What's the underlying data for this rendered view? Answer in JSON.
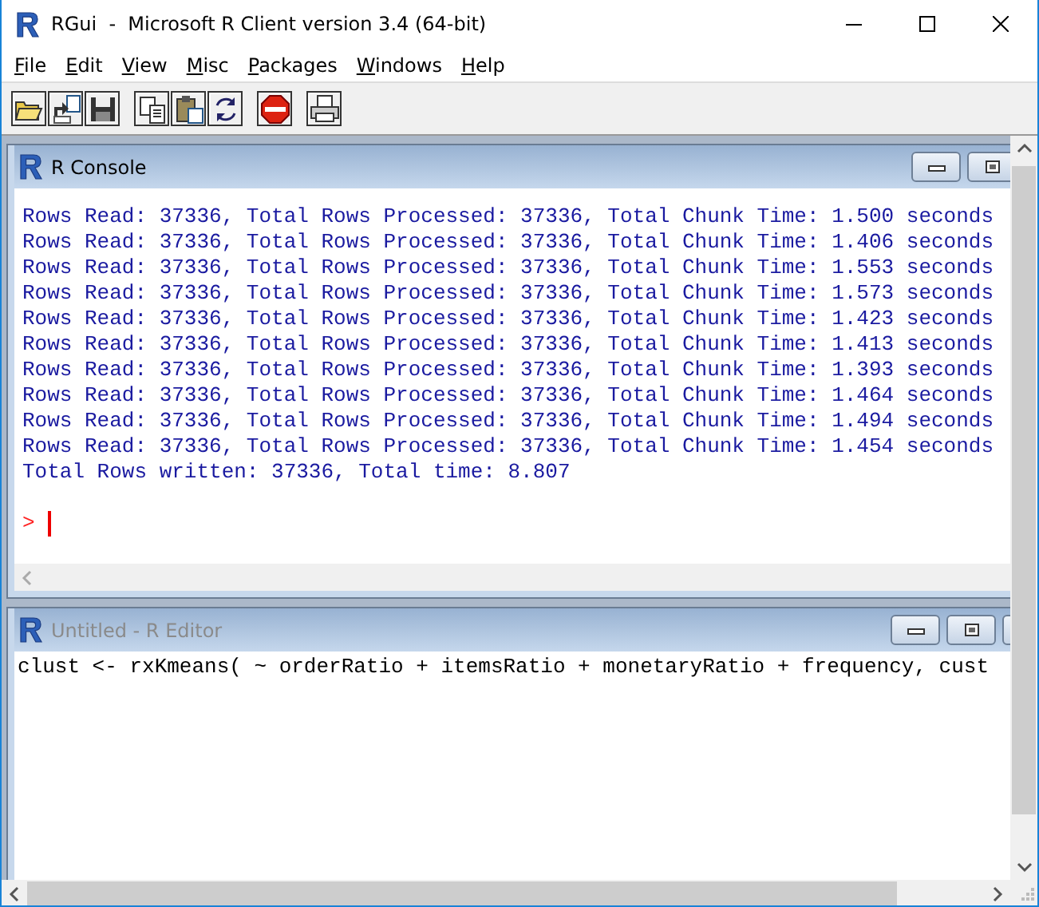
{
  "window": {
    "title": "RGui  -  Microsoft R Client version 3.4 (64-bit)"
  },
  "menu": [
    "File",
    "Edit",
    "View",
    "Misc",
    "Packages",
    "Windows",
    "Help"
  ],
  "toolbar": [
    {
      "buttons": [
        {
          "kind": "open"
        },
        {
          "kind": "load"
        },
        {
          "kind": "save"
        }
      ]
    },
    {
      "buttons": [
        {
          "kind": "copy"
        },
        {
          "kind": "paste"
        },
        {
          "kind": "refresh"
        }
      ]
    },
    {
      "buttons": [
        {
          "kind": "stop"
        }
      ]
    },
    {
      "buttons": [
        {
          "kind": "print"
        }
      ]
    }
  ],
  "console": {
    "title": "R Console",
    "active": true,
    "lines": [
      "Rows Read: 37336, Total Rows Processed: 37336, Total Chunk Time: 1.500 seconds",
      "Rows Read: 37336, Total Rows Processed: 37336, Total Chunk Time: 1.406 seconds",
      "Rows Read: 37336, Total Rows Processed: 37336, Total Chunk Time: 1.553 seconds",
      "Rows Read: 37336, Total Rows Processed: 37336, Total Chunk Time: 1.573 seconds",
      "Rows Read: 37336, Total Rows Processed: 37336, Total Chunk Time: 1.423 seconds",
      "Rows Read: 37336, Total Rows Processed: 37336, Total Chunk Time: 1.413 seconds",
      "Rows Read: 37336, Total Rows Processed: 37336, Total Chunk Time: 1.393 seconds",
      "Rows Read: 37336, Total Rows Processed: 37336, Total Chunk Time: 1.464 seconds",
      "Rows Read: 37336, Total Rows Processed: 37336, Total Chunk Time: 1.494 seconds",
      "Rows Read: 37336, Total Rows Processed: 37336, Total Chunk Time: 1.454 seconds",
      "Total Rows written: 37336, Total time: 8.807"
    ],
    "prompt": ">"
  },
  "editor": {
    "title": "Untitled - R Editor",
    "active": false,
    "lines": [
      "clust <- rxKmeans( ~ orderRatio + itemsRatio + monetaryRatio + frequency, cust"
    ]
  }
}
